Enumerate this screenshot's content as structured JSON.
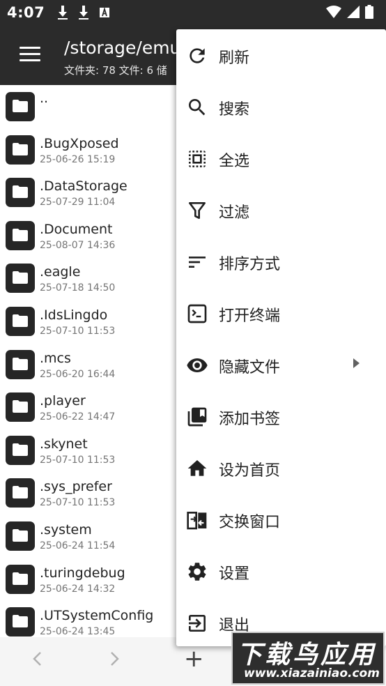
{
  "status_bar": {
    "time": "4:07"
  },
  "toolbar": {
    "title": "/storage/emu",
    "subtitle": "文件夹: 78  文件: 6  储"
  },
  "files": [
    {
      "name": "..",
      "date": ""
    },
    {
      "name": ".BugXposed",
      "date": "25-06-26 15:19"
    },
    {
      "name": ".DataStorage",
      "date": "25-07-29 11:04"
    },
    {
      "name": ".Document",
      "date": "25-08-07 14:36"
    },
    {
      "name": ".eagle",
      "date": "25-07-18 14:50"
    },
    {
      "name": ".IdsLingdo",
      "date": "25-07-10 11:53"
    },
    {
      "name": ".mcs",
      "date": "25-06-20 16:44"
    },
    {
      "name": ".player",
      "date": "25-06-22 14:47"
    },
    {
      "name": ".skynet",
      "date": "25-07-10 11:53"
    },
    {
      "name": ".sys_prefer",
      "date": "25-07-10 11:53"
    },
    {
      "name": ".system",
      "date": "25-06-24 11:54"
    },
    {
      "name": ".turingdebug",
      "date": "25-06-24 14:32"
    },
    {
      "name": ".UTSystemConfig",
      "date": "25-06-24 13:45"
    }
  ],
  "menu": {
    "items": [
      {
        "label": "刷新",
        "icon": "refresh-icon"
      },
      {
        "label": "搜索",
        "icon": "search-icon"
      },
      {
        "label": "全选",
        "icon": "select-all-icon"
      },
      {
        "label": "过滤",
        "icon": "filter-icon"
      },
      {
        "label": "排序方式",
        "icon": "sort-icon"
      },
      {
        "label": "打开终端",
        "icon": "terminal-icon"
      },
      {
        "label": "隐藏文件",
        "icon": "eye-icon",
        "has_submenu": true
      },
      {
        "label": "添加书签",
        "icon": "bookmark-icon"
      },
      {
        "label": "设为首页",
        "icon": "home-icon"
      },
      {
        "label": "交换窗口",
        "icon": "swap-icon"
      },
      {
        "label": "设置",
        "icon": "gear-icon"
      },
      {
        "label": "退出",
        "icon": "exit-icon"
      }
    ]
  },
  "bottom_bar": {
    "add_label": "+"
  },
  "watermark": {
    "cn": "下载鸟应用",
    "en": "www.xiazainiao.com"
  },
  "colors": {
    "toolbar_bg": "#2b2b2b",
    "menu_bg": "#ffffff",
    "folder_icon_bg": "#262626"
  }
}
